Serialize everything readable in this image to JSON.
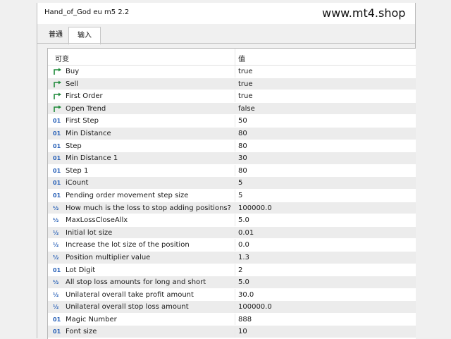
{
  "window": {
    "title": "Hand_of_God eu m5 2.2"
  },
  "watermark": "www.mt4.shop",
  "tabs": [
    {
      "label": "普通"
    },
    {
      "label": "输入"
    }
  ],
  "table": {
    "headers": {
      "variable": "可变",
      "value": "值"
    },
    "rows": [
      {
        "icon": "bool-arrow-icon",
        "name": "Buy",
        "value": "true"
      },
      {
        "icon": "bool-arrow-icon",
        "name": "Sell",
        "value": "true"
      },
      {
        "icon": "bool-arrow-icon",
        "name": "First Order",
        "value": "true"
      },
      {
        "icon": "bool-arrow-icon",
        "name": "Open Trend",
        "value": "false"
      },
      {
        "icon": "int-icon",
        "icon_text": "01",
        "name": "First Step",
        "value": "50"
      },
      {
        "icon": "int-icon",
        "icon_text": "01",
        "name": "Min Distance",
        "value": "80"
      },
      {
        "icon": "int-icon",
        "icon_text": "01",
        "name": "Step",
        "value": "80"
      },
      {
        "icon": "int-icon",
        "icon_text": "01",
        "name": "Min Distance 1",
        "value": "30"
      },
      {
        "icon": "int-icon",
        "icon_text": "01",
        "name": "Step 1",
        "value": "80"
      },
      {
        "icon": "int-icon",
        "icon_text": "01",
        "name": "iCount",
        "value": "5"
      },
      {
        "icon": "int-icon",
        "icon_text": "01",
        "name": "Pending order movement step size",
        "value": "5"
      },
      {
        "icon": "double-icon",
        "icon_text": "½",
        "name": "How much is the loss to stop adding positions?",
        "value": "100000.0"
      },
      {
        "icon": "double-icon",
        "icon_text": "½",
        "name": "MaxLossCloseAllx",
        "value": "5.0"
      },
      {
        "icon": "double-icon",
        "icon_text": "½",
        "name": "Initial lot size",
        "value": "0.01"
      },
      {
        "icon": "double-icon",
        "icon_text": "½",
        "name": "Increase the lot size of the position",
        "value": "0.0"
      },
      {
        "icon": "double-icon",
        "icon_text": "½",
        "name": "Position multiplier value",
        "value": "1.3"
      },
      {
        "icon": "int-icon",
        "icon_text": "01",
        "name": "Lot Digit",
        "value": "2"
      },
      {
        "icon": "double-icon",
        "icon_text": "½",
        "name": "All stop loss amounts for long and short",
        "value": "5.0"
      },
      {
        "icon": "double-icon",
        "icon_text": "½",
        "name": "Unilateral overall take profit amount",
        "value": "30.0"
      },
      {
        "icon": "double-icon",
        "icon_text": "½",
        "name": "Unilateral overall stop loss amount",
        "value": "100000.0"
      },
      {
        "icon": "int-icon",
        "icon_text": "01",
        "name": "Magic Number",
        "value": "888"
      },
      {
        "icon": "int-icon",
        "icon_text": "01",
        "name": "Font size",
        "value": "10"
      }
    ]
  },
  "colors": {
    "bool_icon": "#1f8a3a",
    "num_icon": "#2a62b8",
    "row_alt": "#ececec"
  }
}
